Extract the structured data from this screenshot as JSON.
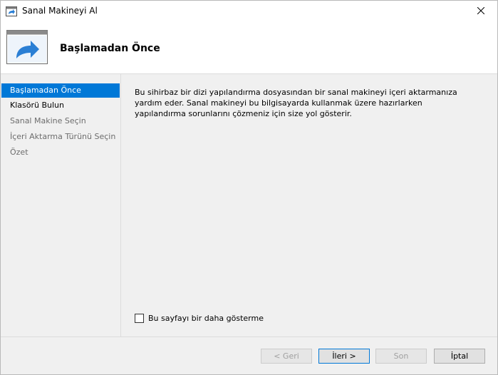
{
  "window": {
    "title": "Sanal Makineyi Al"
  },
  "header": {
    "title": "Başlamadan Önce"
  },
  "sidebar": {
    "items": [
      {
        "label": "Başlamadan Önce"
      },
      {
        "label": "Klasörü Bulun"
      },
      {
        "label": "Sanal Makine Seçin"
      },
      {
        "label": "İçeri Aktarma Türünü Seçin"
      },
      {
        "label": "Özet"
      }
    ]
  },
  "main": {
    "description": "Bu sihirbaz bir dizi yapılandırma dosyasından bir sanal makineyi içeri aktarmanıza yardım eder. Sanal makineyi bu bilgisayarda kullanmak üzere hazırlarken yapılandırma sorunlarını çözmeniz için size yol gösterir.",
    "dont_show_label": "Bu sayfayı bir daha gösterme"
  },
  "footer": {
    "back_label": "< Geri",
    "next_label": "İleri >",
    "finish_label": "Son",
    "cancel_label": "İptal"
  },
  "colors": {
    "accent": "#0078d7",
    "selection": "#0078d7",
    "icon_blue": "#2b7fd4"
  }
}
